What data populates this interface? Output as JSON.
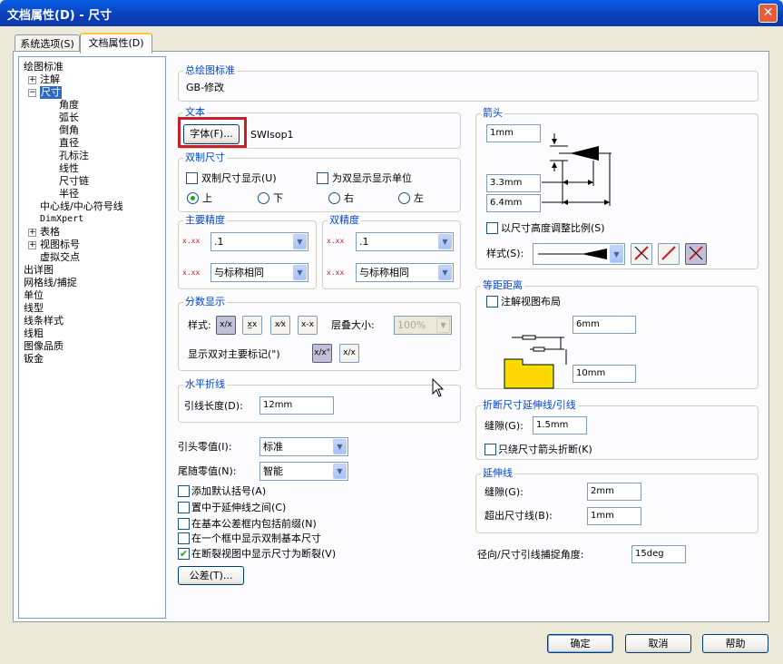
{
  "window": {
    "title": "文档属性(D) - 尺寸",
    "close": "✕"
  },
  "tabs": [
    "系统选项(S)",
    "文档属性(D)"
  ],
  "tree": {
    "items": [
      "绘图标准",
      "注解",
      "尺寸",
      "角度",
      "弧长",
      "倒角",
      "直径",
      "孔标注",
      "线性",
      "尺寸链",
      "半径",
      "中心线/中心符号线",
      "DimXpert",
      "表格",
      "视图标号",
      "虚拟交点",
      "出详图",
      "网格线/捕捉",
      "单位",
      "线型",
      "线条样式",
      "线粗",
      "图像品质",
      "钣金"
    ]
  },
  "standard": {
    "label": "总绘图标准",
    "value": "GB-修改"
  },
  "text": {
    "label": "文本",
    "font_button": "字体(F)...",
    "font_name": "SWIsop1"
  },
  "dual": {
    "label": "双制尺寸",
    "show_dual": "双制尺寸显示(U)",
    "show_units": "为双显示显示单位",
    "top": "上",
    "bottom": "下",
    "right": "右",
    "left": "左"
  },
  "primary_precision": {
    "label": "主要精度",
    "value1": ".1",
    "value2": "与标称相同"
  },
  "dual_precision": {
    "label": "双精度",
    "value1": ".1",
    "value2": "与标称相同"
  },
  "fraction": {
    "label": "分数显示",
    "style": "样式:",
    "stack_size": "层叠大小:",
    "stack_value": "100%",
    "dual_mark": "显示双对主要标记(\")"
  },
  "break": {
    "label": "水平折线",
    "lead_length": "引线长度(D):",
    "lead_value": "12mm"
  },
  "zeros": {
    "leading": "引头零值(I):",
    "leading_value": "标准",
    "trailing": "尾随零值(N):",
    "trailing_value": "智能"
  },
  "options": [
    {
      "label": "添加默认括号(A)",
      "checked": false
    },
    {
      "label": "置中于延伸线之间(C)",
      "checked": false
    },
    {
      "label": "在基本公差框内包括前缀(N)",
      "checked": false
    },
    {
      "label": "在一个框中显示双制基本尺寸",
      "checked": false
    },
    {
      "label": "在断裂视图中显示尺寸为断裂(V)",
      "checked": true
    }
  ],
  "tolerance_button": "公差(T)...",
  "arrows": {
    "label": "箭头",
    "v1": "1mm",
    "v2": "3.3mm",
    "v3": "6.4mm",
    "scale": "以尺寸高度调整比例(S)",
    "style": "样式(S):"
  },
  "offset": {
    "label": "等距距离",
    "break_layout": "注解视图布局",
    "v1": "6mm",
    "v2": "10mm"
  },
  "break_ext": {
    "label": "折断尺寸延伸线/引线",
    "gap": "缝隙(G):",
    "gap_value": "1.5mm",
    "arrow_only": "只绕尺寸箭头折断(K)"
  },
  "extension": {
    "label": "延伸线",
    "gap": "缝隙(G):",
    "gap_value": "2mm",
    "beyond": "超出尺寸线(B):",
    "beyond_value": "1mm"
  },
  "snap": {
    "label": "径向/尺寸引线捕捉角度:",
    "value": "15deg"
  },
  "footer": {
    "ok": "确定",
    "cancel": "取消",
    "help": "帮助"
  },
  "colors": {
    "titlebar": "#0a5fe6",
    "group_label": "#0046d5",
    "highlight": "#c8202a"
  }
}
